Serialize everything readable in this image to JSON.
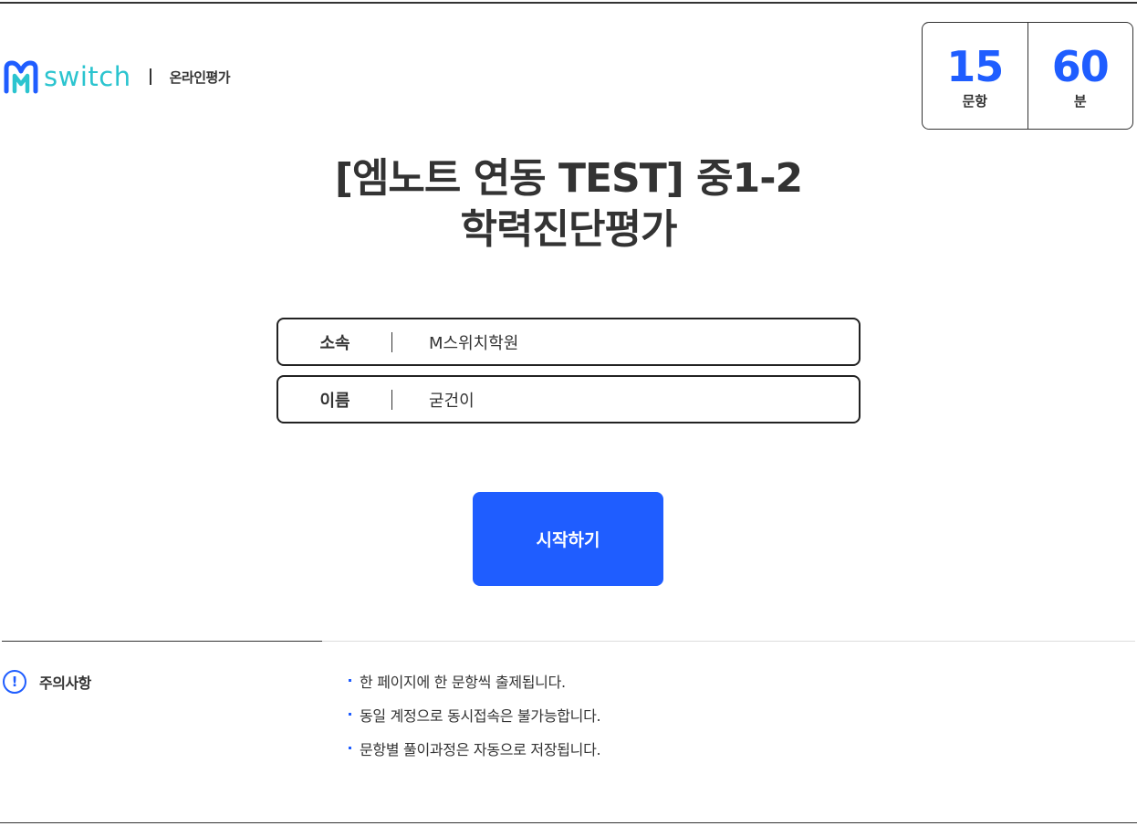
{
  "header": {
    "logo_text": "switch",
    "subtitle": "온라인평가"
  },
  "stats": [
    {
      "value": "15",
      "label": "문항"
    },
    {
      "value": "60",
      "label": "분"
    }
  ],
  "title": {
    "line1": "[엠노트 연동 TEST] 중1-2",
    "line2": "학력진단평가"
  },
  "fields": [
    {
      "label": "소속",
      "value": "M스위치학원"
    },
    {
      "label": "이름",
      "value": "굳건이"
    }
  ],
  "start_button": "시작하기",
  "notice": {
    "title": "주의사항",
    "icon_glyph": "!",
    "items": [
      "한 페이지에 한 문항씩 출제됩니다.",
      "동일 계정으로 동시접속은 불가능합니다.",
      "문항별 풀이과정은 자동으로 저장됩니다."
    ]
  },
  "colors": {
    "accent": "#1f5dff",
    "logo": "#2bc4cf",
    "text": "#333333"
  }
}
